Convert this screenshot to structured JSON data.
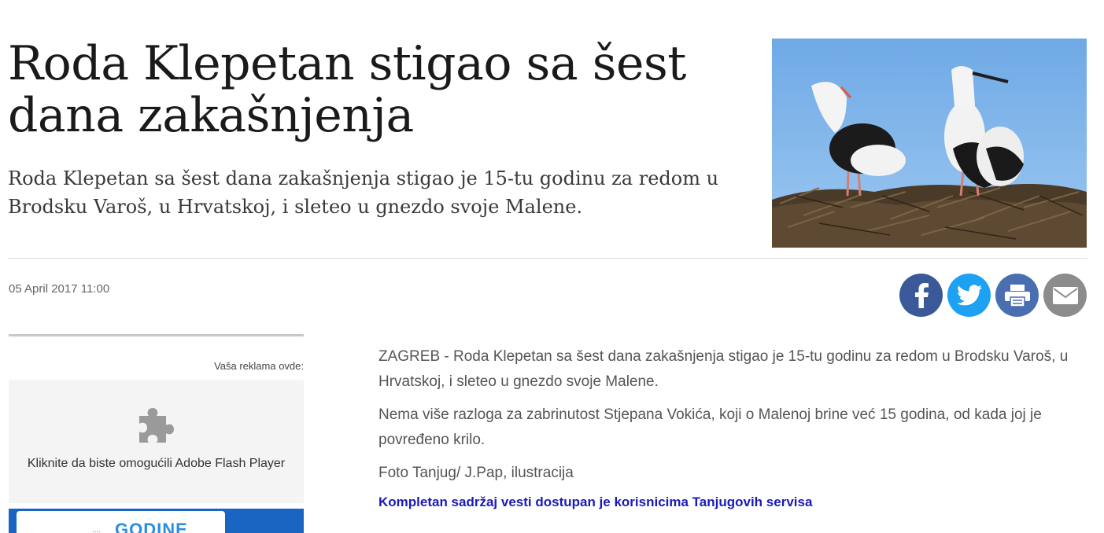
{
  "article": {
    "title": "Roda Klepetan stigao sa šest dana zakašnjenja",
    "lead": "Roda Klepetan sa šest dana zakašnjenja stigao je 15-tu godinu za redom u Brodsku Varoš, u Hrvatskoj, i sleteo u gnezdo svoje Malene.",
    "date": "05 April 2017 11:00",
    "paragraphs": [
      "ZAGREB - Roda Klepetan sa šest dana zakašnjenja stigao je 15-tu godinu za redom u Brodsku Varoš, u Hrvatskoj, i sleteo u gnezdo svoje Malene.",
      "Nema više razloga za zabrinutost Stjepana Vokića, koji o Malenoj brine već 15 godina, od kada joj je povređeno krilo."
    ],
    "photo_credit": "Foto Tanjug/ J.Pap, ilustracija",
    "notice_link": "Kompletan sadržaj vesti dostupan je korisnicima Tanjugovih servisa"
  },
  "share": {
    "icons": [
      "facebook-icon",
      "twitter-icon",
      "print-icon",
      "email-icon"
    ],
    "colors": {
      "facebook": "#3b5998",
      "twitter": "#1da1f2",
      "print": "#4a6fb0",
      "email": "#8c8c8c"
    }
  },
  "ad": {
    "label": "Vaša reklama ovde:",
    "flash_text": "Kliknite da biste omogućili Adobe Flash Player",
    "banner_text": "GODINE",
    "banner_small": "...."
  }
}
